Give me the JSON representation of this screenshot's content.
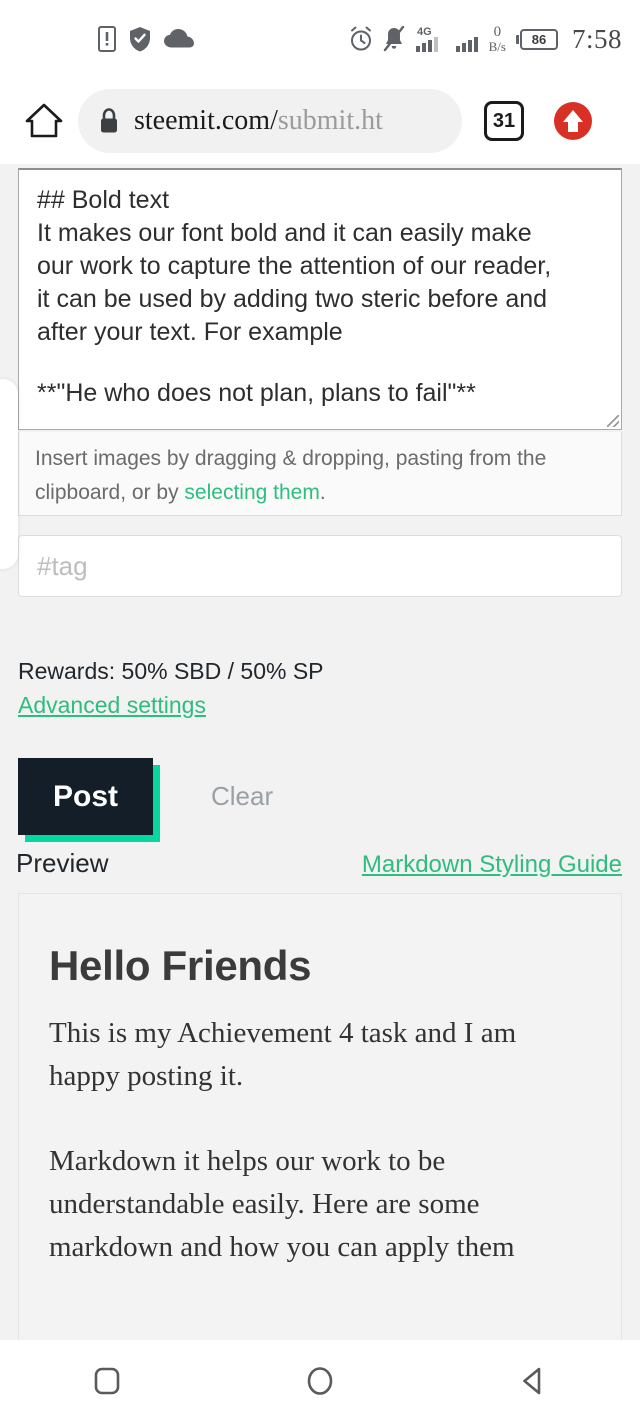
{
  "status_bar": {
    "left_icons": [
      "phone-alert-icon",
      "shield-check-icon",
      "cloud-icon"
    ],
    "right_icons": [
      "alarm-icon",
      "bell-muted-icon",
      "signal-4g-icon",
      "signal-icon"
    ],
    "network_type": "4G",
    "data_rate_value": "0",
    "data_rate_unit": "B/s",
    "battery_percent": "86",
    "time": "7:58"
  },
  "browser": {
    "home_icon": "home-icon",
    "lock_icon": "lock-icon",
    "url_domain": "steemit.com/",
    "url_path": "submit.ht",
    "tab_count": "31",
    "menu_icon": "upload-arrow-icon"
  },
  "editor": {
    "lines": [
      "## Bold text",
      "It makes our font bold and it can easily make",
      "our work to capture the attention of our reader,",
      "it can be used by adding two steric before and",
      "after your text. For example",
      "",
      "**\"He who does not plan, plans to fail\"**"
    ]
  },
  "dropzone": {
    "text_before": "Insert images by dragging & dropping, pasting from the clipboard, or by ",
    "link_text": "selecting them",
    "text_after": "."
  },
  "tag_input": {
    "placeholder": "#tag",
    "value": ""
  },
  "rewards": {
    "label": "Rewards: 50% SBD / 50% SP",
    "advanced_link": "Advanced settings"
  },
  "actions": {
    "post_label": "Post",
    "clear_label": "Clear",
    "post_bg": "#141e29",
    "post_shadow": "#06d6a0"
  },
  "preview": {
    "label": "Preview",
    "guide_link": "Markdown Styling Guide",
    "heading": "Hello Friends",
    "paragraph_1": "This is my Achievement 4 task and I am happy posting it.",
    "paragraph_2": "Markdown it helps our work to be understandable easily. Here are some markdown and how you can apply them"
  },
  "nav_bar": {
    "recents_icon": "square-recents-icon",
    "home_icon": "circle-home-icon",
    "back_icon": "triangle-back-icon"
  },
  "theme": {
    "accent_green": "#2fbd7f",
    "page_bg": "#f2f2f2",
    "menu_red": "#d93025"
  }
}
